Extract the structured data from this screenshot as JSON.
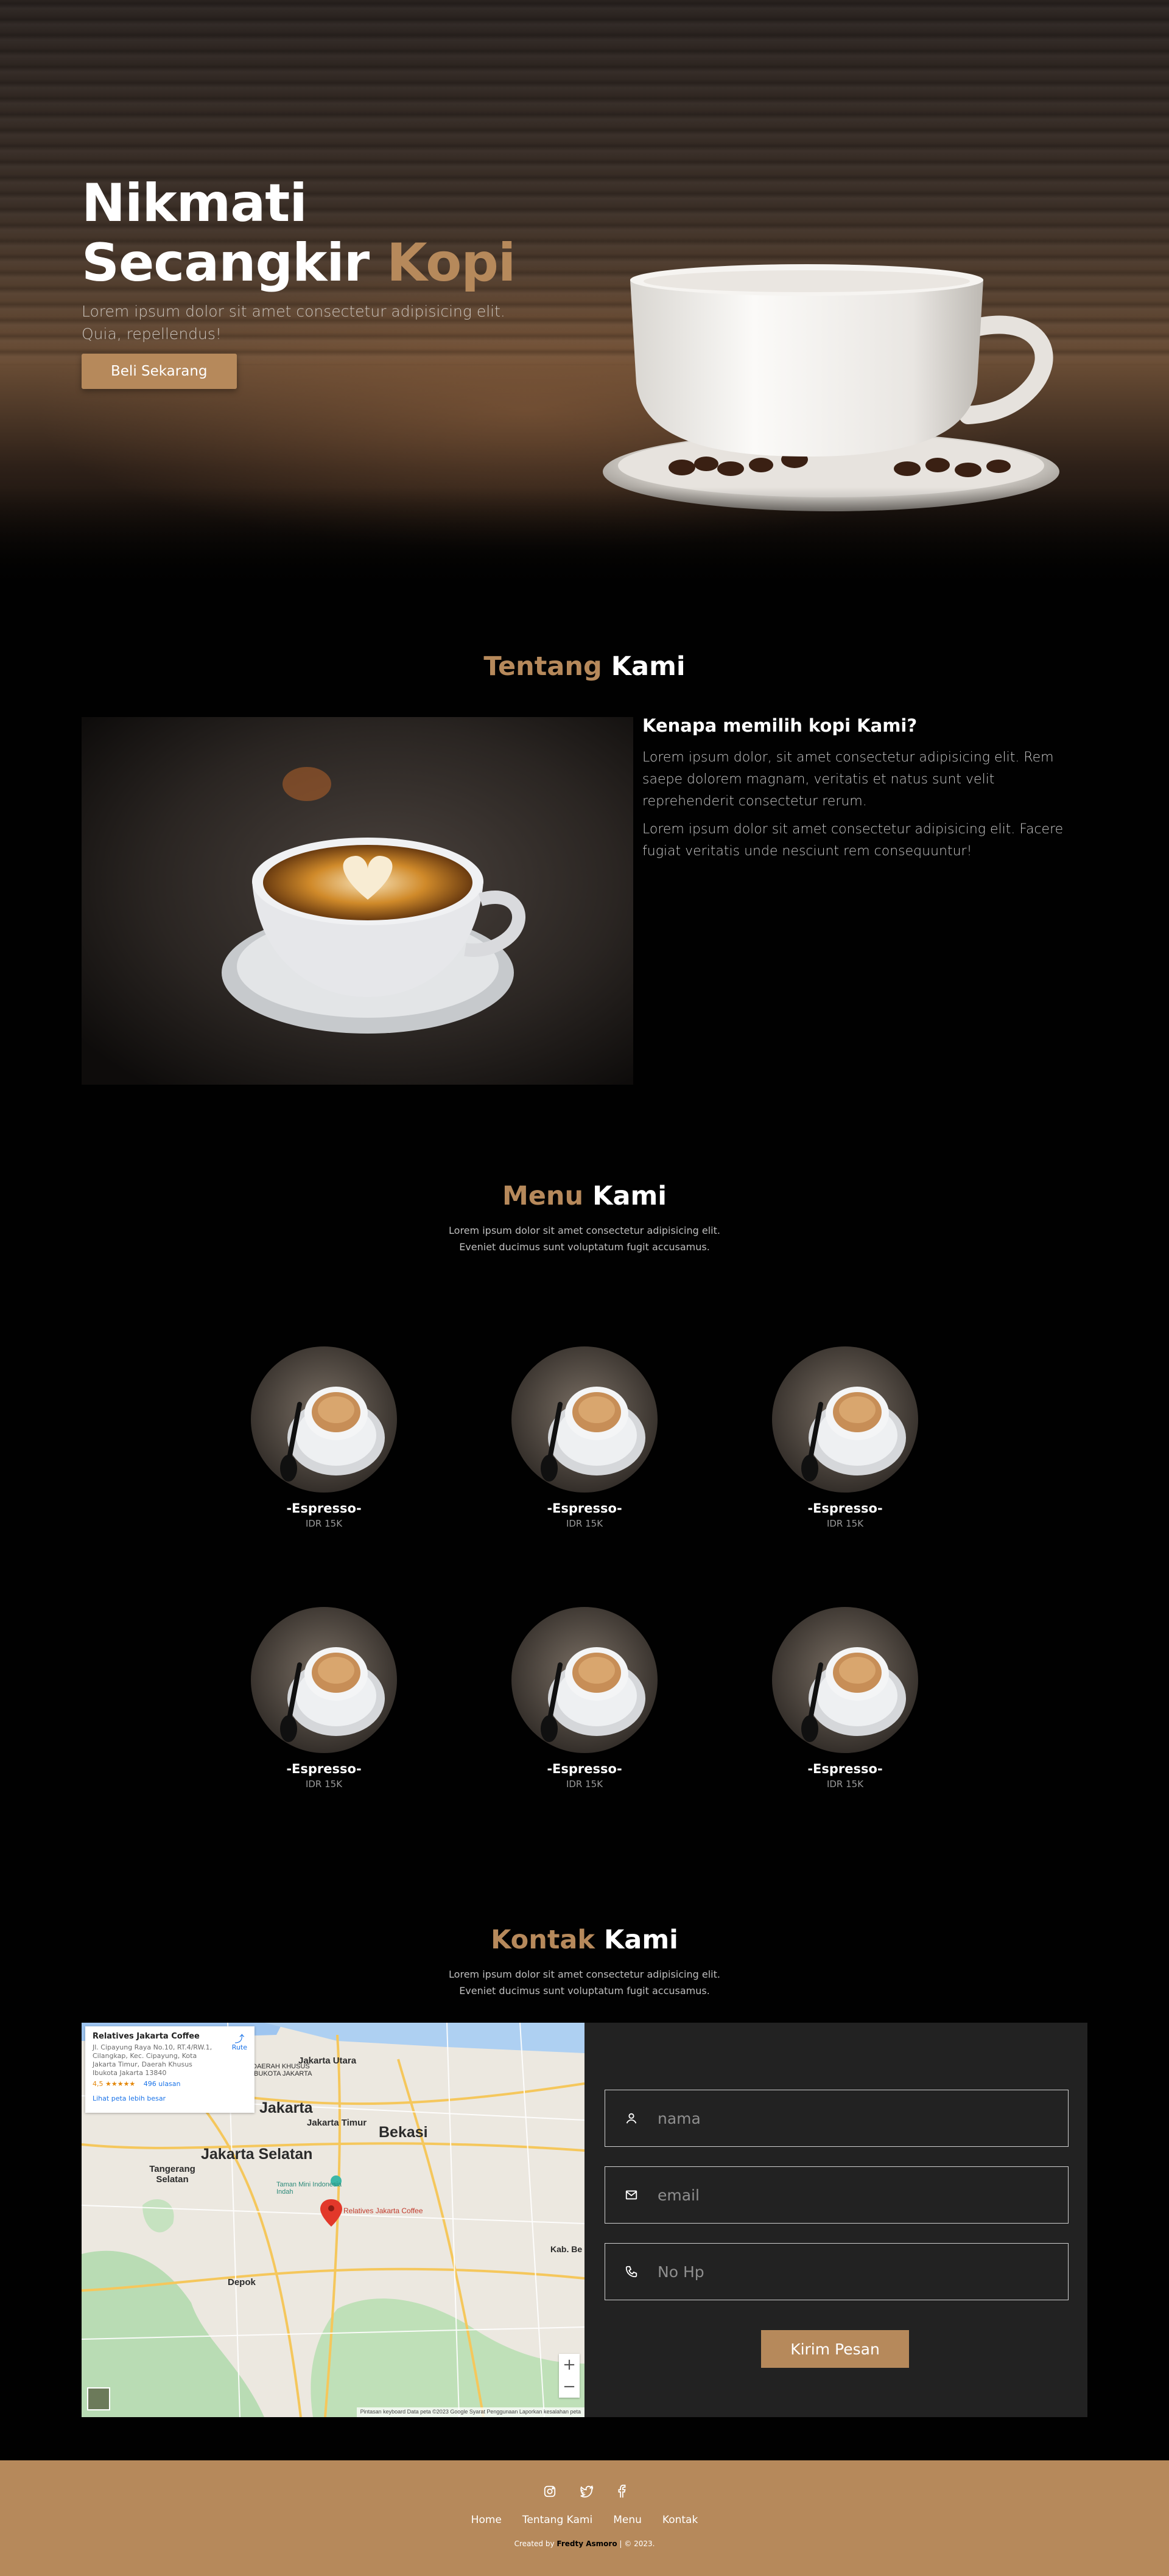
{
  "hero": {
    "title_line1": "Nikmati",
    "title_line2": "Secangkir",
    "title_accent": "Kopi",
    "description": "Lorem ipsum dolor sit amet consectetur adipisicing elit. Quia, repellendus!",
    "button_label": "Beli Sekarang"
  },
  "about": {
    "title_accent": "Tentang",
    "title_rest": "Kami",
    "heading": "Kenapa memilih kopi Kami?",
    "paragraph1": "Lorem ipsum dolor, sit amet consectetur adipisicing elit. Rem saepe dolorem magnam, veritatis et natus sunt velit reprehenderit consectetur rerum.",
    "paragraph2": "Lorem ipsum dolor sit amet consectetur adipisicing elit. Facere fugiat veritatis unde nesciunt rem consequuntur!"
  },
  "menu": {
    "title_accent": "Menu",
    "title_rest": "Kami",
    "subtitle_line1": "Lorem ipsum dolor sit amet consectetur adipisicing elit.",
    "subtitle_line2": "Eveniet ducimus sunt voluptatum fugit accusamus.",
    "items": [
      {
        "name": "-Espresso-",
        "price": "IDR 15K"
      },
      {
        "name": "-Espresso-",
        "price": "IDR 15K"
      },
      {
        "name": "-Espresso-",
        "price": "IDR 15K"
      },
      {
        "name": "-Espresso-",
        "price": "IDR 15K"
      },
      {
        "name": "-Espresso-",
        "price": "IDR 15K"
      },
      {
        "name": "-Espresso-",
        "price": "IDR 15K"
      }
    ]
  },
  "contact": {
    "title_accent": "Kontak",
    "title_rest": "Kami",
    "subtitle_line1": "Lorem ipsum dolor sit amet consectetur adipisicing elit.",
    "subtitle_line2": "Eveniet ducimus sunt voluptatum fugit accusamus.",
    "map": {
      "place_name": "Relatives Jakarta Coffee",
      "address": "Jl. Cipayung Raya No.10, RT.4/RW.1, Cilangkap, Kec. Cipayung, Kota Jakarta Timur, Daerah Khusus Ibukota Jakarta 13840",
      "rating": "4,5 ★★★★★",
      "reviews": "496 ulasan",
      "route_label": "Rute",
      "larger_map_link": "Lihat peta lebih besar",
      "marker_label": "Relatives Jakarta Coffee",
      "labels": {
        "jakarta_utara": "Jakarta Utara",
        "jakarta": "Jakarta",
        "jakarta_timur": "Jakarta Timur",
        "jakarta_selatan": "Jakarta Selatan",
        "bekasi": "Bekasi",
        "tangerang_selatan": "Tangerang Selatan",
        "depok": "Depok",
        "taman_mini": "Taman Mini Indonesia Indah",
        "kab_bekasi": "Kab. Be",
        "daerah_khusus": "DAERAH KHUSUS IBUKOTA JAKARTA"
      },
      "attribution": "Pintasan keyboard   Data peta ©2023 Google   Syarat Penggunaan   Laporkan kesalahan peta",
      "zoom_in": "+",
      "zoom_out": "−"
    },
    "form": {
      "name_placeholder": "nama",
      "email_placeholder": "email",
      "phone_placeholder": "No Hp",
      "submit_label": "Kirim Pesan"
    }
  },
  "footer": {
    "nav": [
      "Home",
      "Tentang Kami",
      "Menu",
      "Kontak"
    ],
    "credit_prefix": "Created by",
    "credit_name": "Fredty Asmoro",
    "credit_suffix": "| © 2023."
  },
  "colors": {
    "accent": "#b6895b",
    "background": "#010101",
    "panel": "#222222"
  }
}
